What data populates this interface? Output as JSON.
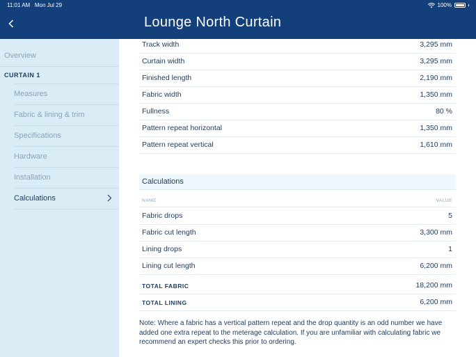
{
  "status_bar": {
    "time": "11:01 AM",
    "date": "Mon Jul 29",
    "battery": "100%"
  },
  "header": {
    "title": "Lounge North Curtain"
  },
  "sidebar": {
    "overview": "Overview",
    "section": "CURTAIN 1",
    "items": [
      {
        "label": "Measures"
      },
      {
        "label": "Fabric & lining & trim"
      },
      {
        "label": "Specifications"
      },
      {
        "label": "Hardware"
      },
      {
        "label": "Installation"
      },
      {
        "label": "Calculations",
        "active": true
      }
    ]
  },
  "measures": [
    {
      "label": "Track width",
      "value": "3,295 mm"
    },
    {
      "label": "Curtain width",
      "value": "3,295 mm"
    },
    {
      "label": "Finished length",
      "value": "2,190 mm"
    },
    {
      "label": "Fabric width",
      "value": "1,350 mm"
    },
    {
      "label": "Fullness",
      "value": "80 %"
    },
    {
      "label": "Pattern repeat horizontal",
      "value": "1,350 mm"
    },
    {
      "label": "Pattern repeat vertical",
      "value": "1,610 mm"
    }
  ],
  "calculations": {
    "title": "Calculations",
    "col_name": "NAME",
    "col_value": "VALUE",
    "rows": [
      {
        "label": "Fabric drops",
        "value": "5"
      },
      {
        "label": "Fabric cut length",
        "value": "3,300 mm"
      },
      {
        "label": "Lining drops",
        "value": "1"
      },
      {
        "label": "Lining cut length",
        "value": "6,200 mm"
      }
    ],
    "totals": [
      {
        "label": "TOTAL FABRIC",
        "value": "18,200 mm"
      },
      {
        "label": "TOTAL LINING",
        "value": "6,200 mm"
      }
    ]
  },
  "note": "Note: Where a fabric has a vertical pattern repeat and the drop quantity is an odd number we have added one extra repeat to the meterage calculation. If you are unfamiliar with calculating fabric we recommend an expert checks this prior to ordering."
}
